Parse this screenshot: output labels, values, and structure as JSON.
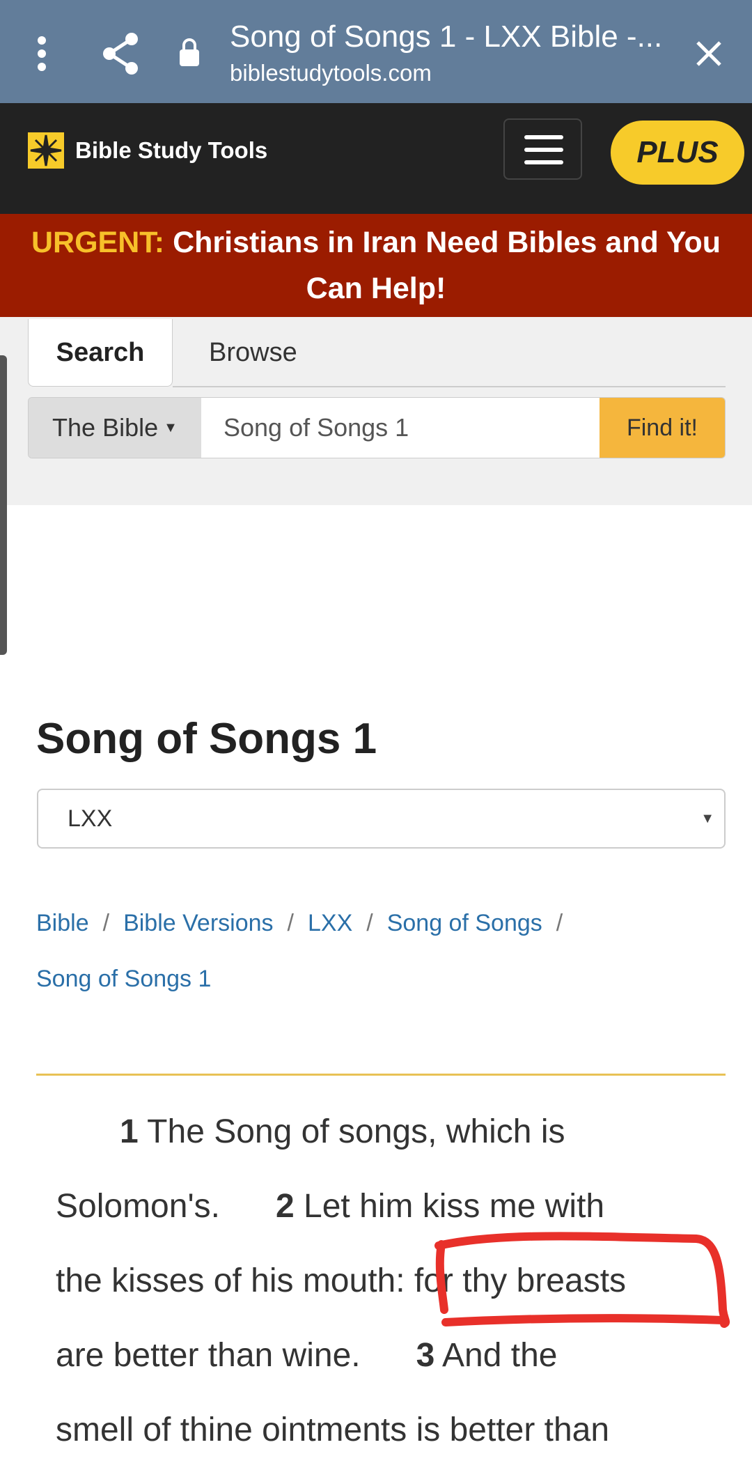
{
  "browser": {
    "title": "Song of Songs 1 - LXX Bible -...",
    "url": "biblestudytools.com",
    "icons": [
      "more-vert-icon",
      "share-icon",
      "lock-icon",
      "close-icon"
    ]
  },
  "nav": {
    "logo_text": "Bible Study Tools",
    "plus_label": "PLUS"
  },
  "banner": {
    "urgent": "URGENT:",
    "message": "Christians in Iran Need Bibles and You Can Help!"
  },
  "search": {
    "tabs": [
      {
        "label": "Search",
        "active": true
      },
      {
        "label": "Browse"
      }
    ],
    "scope": "The Bible",
    "query": "Song of Songs 1",
    "button": "Find it!"
  },
  "page": {
    "title": "Song of Songs 1",
    "version": "LXX"
  },
  "breadcrumb": [
    "Bible",
    "Bible Versions",
    "LXX",
    "Song of Songs",
    "Song of Songs 1"
  ],
  "verses": [
    [
      {
        "num": "1"
      },
      {
        "text": " The Song of songs, which is"
      }
    ],
    [
      {
        "text": "Solomon's.      "
      },
      {
        "num": "2"
      },
      {
        "text": " Let him kiss me with"
      }
    ],
    [
      {
        "text": "the kisses of his mouth: for thy breasts"
      }
    ],
    [
      {
        "text": "are better than wine.      "
      },
      {
        "num": "3"
      },
      {
        "text": " And the"
      }
    ],
    [
      {
        "text": "smell of thine ointments is better than"
      }
    ]
  ],
  "colors": {
    "browser_bar": "#627d9a",
    "nav": "#222222",
    "banner": "#9b1c00",
    "accent": "#f7cb2a",
    "link": "#2a6fa8",
    "annotation": "#e8302a"
  }
}
